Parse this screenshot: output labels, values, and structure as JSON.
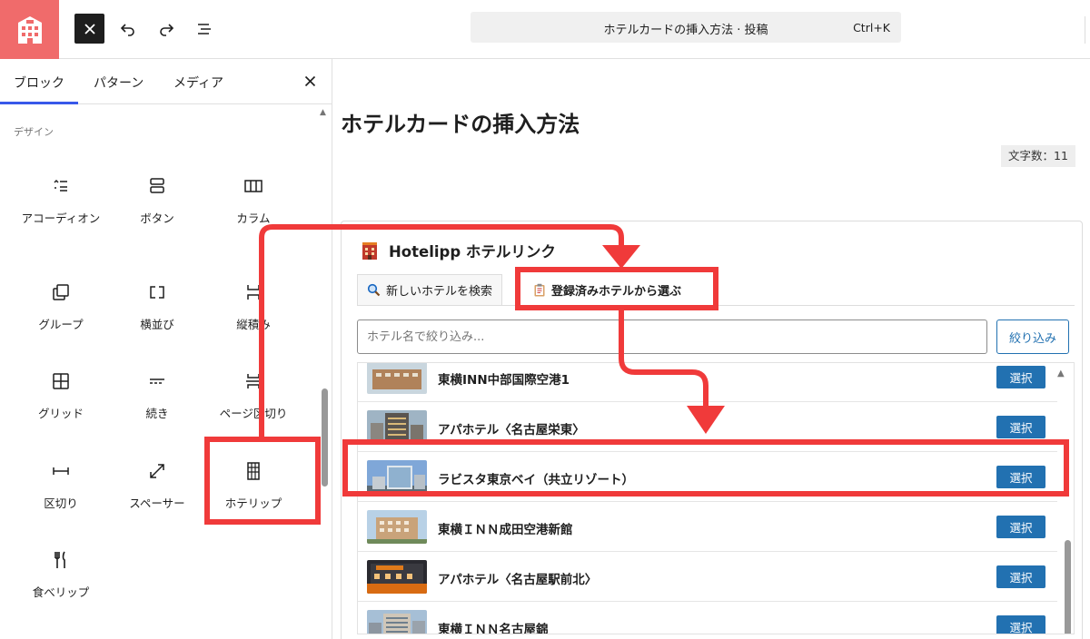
{
  "topbar": {
    "command_title": "ホテルカードの挿入方法 · 投稿",
    "command_shortcut": "Ctrl+K"
  },
  "inserter": {
    "tabs": [
      {
        "label": "ブロック",
        "active": true
      },
      {
        "label": "パターン"
      },
      {
        "label": "メディア"
      }
    ],
    "section_label": "デザイン",
    "blocks": [
      {
        "label": "アコーディオン",
        "icon": "accordion-icon"
      },
      {
        "label": "ボタン",
        "icon": "buttons-icon"
      },
      {
        "label": "カラム",
        "icon": "columns-icon"
      },
      {
        "label": "グループ",
        "icon": "group-icon"
      },
      {
        "label": "横並び",
        "icon": "row-icon"
      },
      {
        "label": "縦積み",
        "icon": "stack-icon"
      },
      {
        "label": "グリッド",
        "icon": "grid-icon"
      },
      {
        "label": "続き",
        "icon": "more-icon"
      },
      {
        "label": "ページ区切り",
        "icon": "page-break-icon"
      },
      {
        "label": "区切り",
        "icon": "separator-icon"
      },
      {
        "label": "スペーサー",
        "icon": "spacer-icon"
      },
      {
        "label": "ホテリップ",
        "icon": "hotel-building-icon"
      },
      {
        "label": "食べリップ",
        "icon": "cutlery-icon"
      }
    ]
  },
  "editor": {
    "post_title": "ホテルカードの挿入方法",
    "word_count": "文字数：11"
  },
  "hotel_card": {
    "heading": "Hotelipp ホテルリンク",
    "tabs": [
      {
        "label": "新しいホテルを検索",
        "icon": "search-icon"
      },
      {
        "label": "登録済みホテルから選ぶ",
        "icon": "clipboard-icon",
        "active": true
      }
    ],
    "filter_placeholder": "ホテル名で絞り込み...",
    "filter_button": "絞り込み",
    "select_label": "選択",
    "hotels": [
      {
        "name": "東横INN中部国際空港1"
      },
      {
        "name": "アパホテル〈名古屋栄東〉"
      },
      {
        "name": "ラビスタ東京ベイ（共立リゾート）",
        "highlighted": true
      },
      {
        "name": "東横ＩＮＮ成田空港新館"
      },
      {
        "name": "アパホテル〈名古屋駅前北〉"
      },
      {
        "name": "東横ＩＮＮ名古屋錦"
      }
    ]
  },
  "colors": {
    "logo_bg": "#f06b6b",
    "accent_blue": "#2271b1",
    "annotation_red": "#f03a3a",
    "tab_indicator": "#3858e9"
  }
}
